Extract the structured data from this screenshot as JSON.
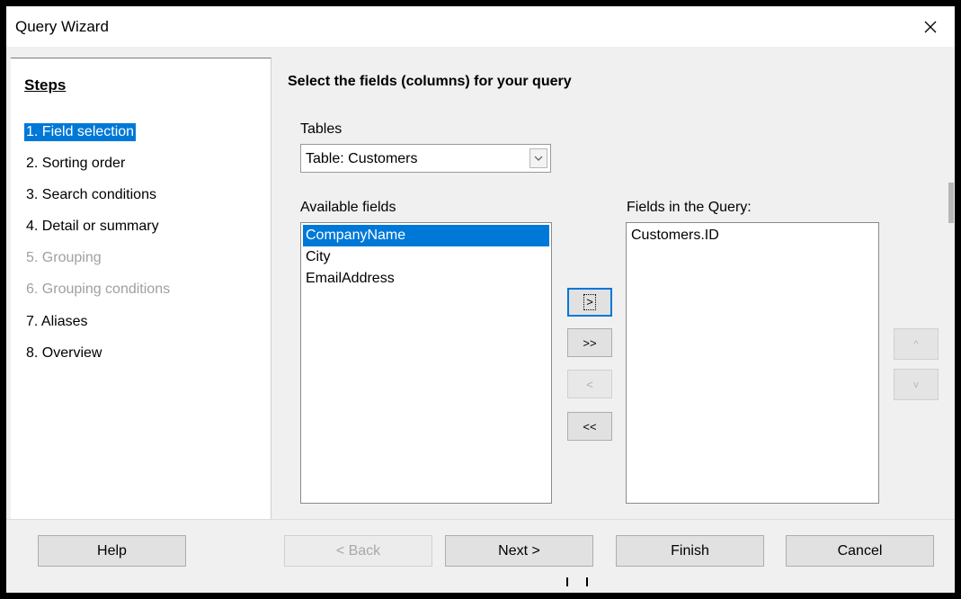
{
  "window": {
    "title": "Query Wizard"
  },
  "steps": {
    "title": "Steps",
    "items": [
      {
        "label": "1. Field selection",
        "state": "selected"
      },
      {
        "label": "2. Sorting order",
        "state": "enabled"
      },
      {
        "label": "3. Search conditions",
        "state": "enabled"
      },
      {
        "label": "4. Detail or summary",
        "state": "enabled"
      },
      {
        "label": "5. Grouping",
        "state": "disabled"
      },
      {
        "label": "6. Grouping conditions",
        "state": "disabled"
      },
      {
        "label": "7. Aliases",
        "state": "enabled"
      },
      {
        "label": "8. Overview",
        "state": "enabled"
      }
    ]
  },
  "main": {
    "heading": "Select the fields (columns) for your query",
    "tables_label": "Tables",
    "tables_value": "Table: Customers",
    "available_label": "Available fields",
    "available_fields": [
      "CompanyName",
      "City",
      "EmailAddress"
    ],
    "query_label": "Fields in the Query:",
    "query_fields": [
      "Customers.ID"
    ],
    "move_buttons": {
      "add": ">",
      "add_all": ">>",
      "remove": "<",
      "remove_all": "<<"
    },
    "order_buttons": {
      "up": "^",
      "down": "v"
    }
  },
  "footer": {
    "help": "Help",
    "back": "< Back",
    "next": "Next >",
    "finish": "Finish",
    "cancel": "Cancel"
  },
  "colors": {
    "accent": "#0078d7",
    "panel": "#f0f0f0"
  }
}
